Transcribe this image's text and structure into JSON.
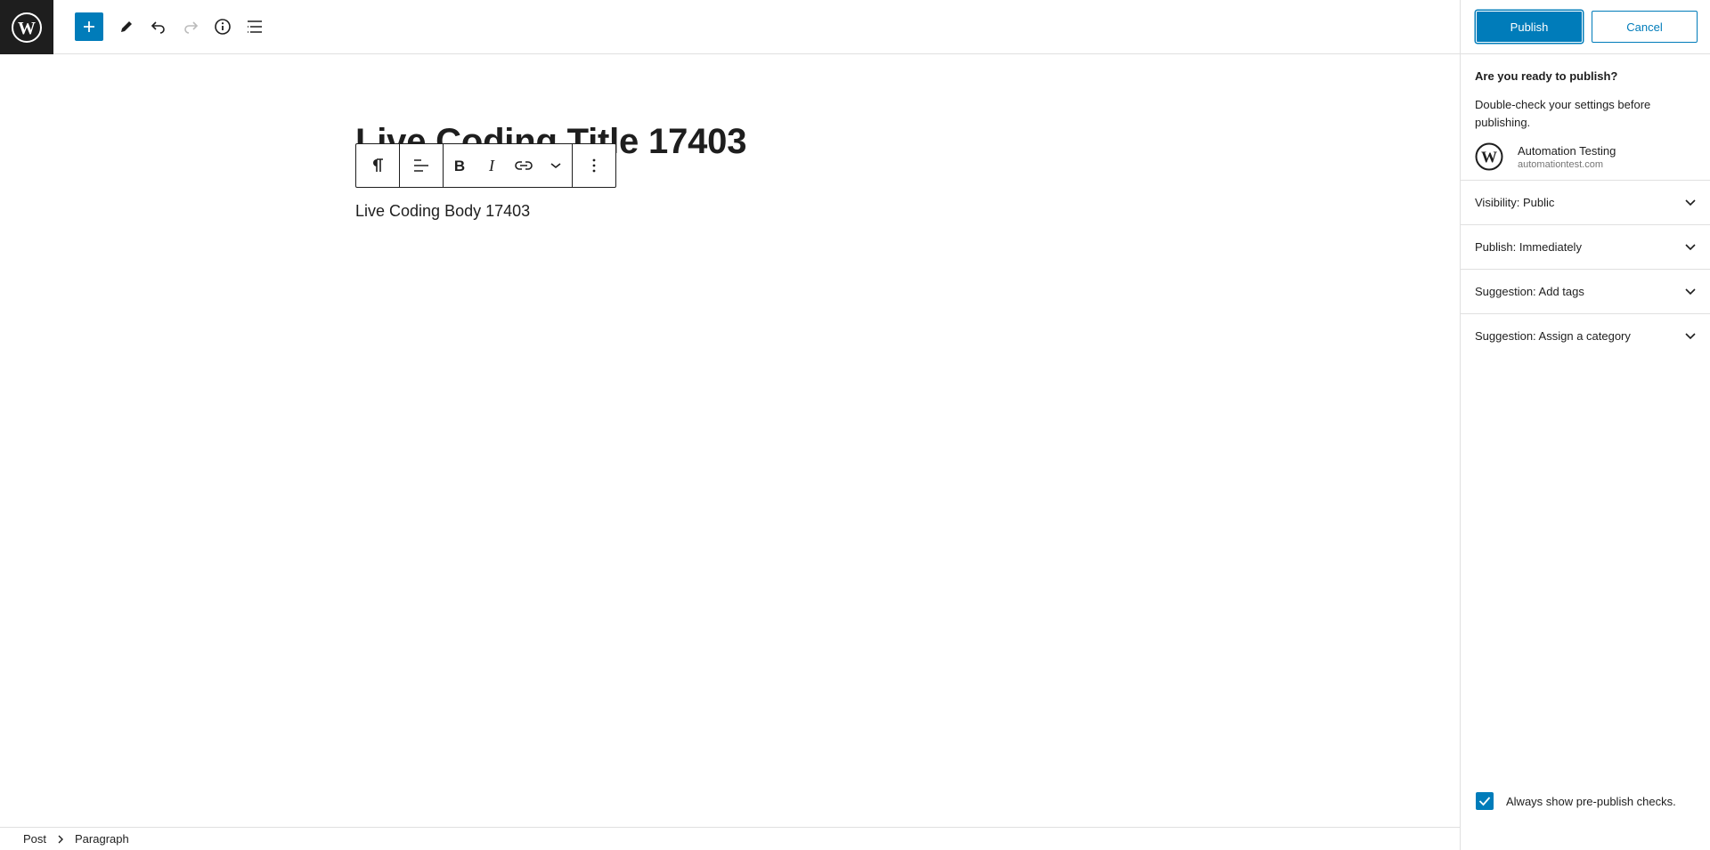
{
  "header": {
    "logo_icon": "wordpress-logo-icon",
    "tools": [
      {
        "name": "add-block",
        "icon": "plus-icon"
      },
      {
        "name": "tools",
        "icon": "pencil-icon"
      },
      {
        "name": "undo",
        "icon": "undo-icon"
      },
      {
        "name": "redo",
        "icon": "redo-icon"
      },
      {
        "name": "details",
        "icon": "info-icon"
      },
      {
        "name": "list-view",
        "icon": "list-view-icon"
      }
    ],
    "accent_color": "#007cba"
  },
  "editor": {
    "title": "Live Coding Title 17403",
    "body": "Live Coding Body 17403",
    "block_toolbar": [
      "paragraph-icon",
      "align-left-icon",
      "bold-icon",
      "italic-icon",
      "link-icon",
      "chevron-down-icon",
      "more-vertical-icon"
    ]
  },
  "publish_panel": {
    "publish_label": "Publish",
    "cancel_label": "Cancel",
    "heading": "Are you ready to publish?",
    "description": "Double-check your settings before publishing.",
    "site_name": "Automation Testing",
    "site_url": "automationtest.com",
    "sections": [
      {
        "label": "Visibility: Public"
      },
      {
        "label": "Publish: Immediately"
      },
      {
        "label": "Suggestion: Add tags"
      },
      {
        "label": "Suggestion: Assign a category"
      }
    ],
    "always_show_label": "Always show pre-publish checks.",
    "always_show_checked": true
  },
  "breadcrumb": [
    "Post",
    "Paragraph"
  ]
}
